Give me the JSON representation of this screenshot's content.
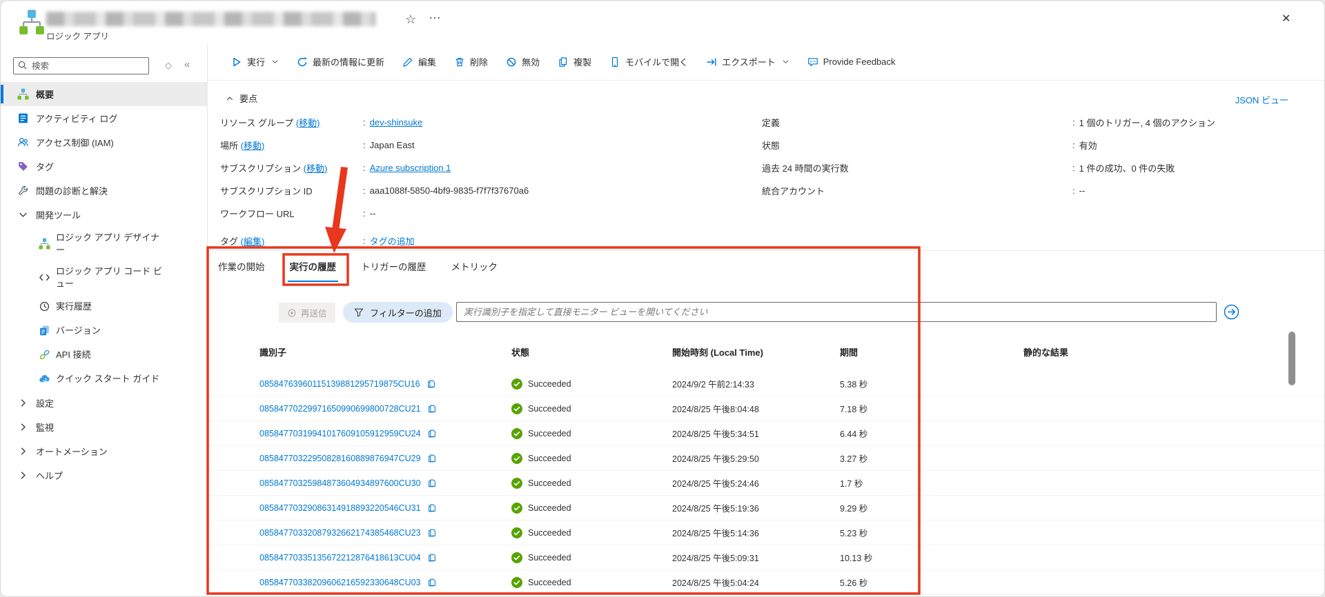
{
  "window": {
    "close": "✕"
  },
  "header": {
    "app_type_label": "ロジック アプリ",
    "star": "☆",
    "more": "…"
  },
  "sidebar": {
    "search_placeholder": "検索",
    "pin": "◇",
    "collapse": "«",
    "items": [
      {
        "label": "概要",
        "icon": "logic-app-icon",
        "cls": "selected"
      },
      {
        "label": "アクティビティ ログ",
        "icon": "activity-log-icon"
      },
      {
        "label": "アクセス制御 (IAM)",
        "icon": "access-control-icon"
      },
      {
        "label": "タグ",
        "icon": "tag-icon"
      },
      {
        "label": "問題の診断と解決",
        "icon": "diagnose-icon"
      },
      {
        "label": "開発ツール",
        "icon": "chevron-down-icon",
        "cls": "group"
      },
      {
        "label": "ロジック アプリ デザイナー",
        "icon": "designer-icon",
        "cls": "sub"
      },
      {
        "label": "ロジック アプリ コード ビュー",
        "icon": "code-view-icon",
        "cls": "sub"
      },
      {
        "label": "実行履歴",
        "icon": "run-history-icon",
        "cls": "sub"
      },
      {
        "label": "バージョン",
        "icon": "versions-icon",
        "cls": "sub"
      },
      {
        "label": "API 接続",
        "icon": "api-connections-icon",
        "cls": "sub"
      },
      {
        "label": "クイック スタート ガイド",
        "icon": "quickstart-icon",
        "cls": "sub"
      },
      {
        "label": "設定",
        "icon": "chevron-right-icon",
        "cls": "group"
      },
      {
        "label": "監視",
        "icon": "chevron-right-icon",
        "cls": "group"
      },
      {
        "label": "オートメーション",
        "icon": "chevron-right-icon",
        "cls": "group"
      },
      {
        "label": "ヘルプ",
        "icon": "chevron-right-icon",
        "cls": "group"
      }
    ]
  },
  "toolbar": {
    "buttons": [
      {
        "label": "実行",
        "icon": "play-icon",
        "caret": true
      },
      {
        "label": "最新の情報に更新",
        "icon": "refresh-icon"
      },
      {
        "label": "編集",
        "icon": "edit-icon"
      },
      {
        "label": "削除",
        "icon": "delete-icon"
      },
      {
        "label": "無効",
        "icon": "disable-icon"
      },
      {
        "label": "複製",
        "icon": "clone-icon"
      },
      {
        "label": "モバイルで開く",
        "icon": "mobile-icon"
      },
      {
        "label": "エクスポート",
        "icon": "export-icon",
        "caret": true
      },
      {
        "label": "Provide Feedback",
        "icon": "feedback-icon"
      }
    ]
  },
  "essentials": {
    "title": "要点",
    "json_view_label": "JSON ビュー",
    "left": [
      {
        "label": "リソース グループ",
        "link": "(移動)",
        "sep": ":",
        "value": "dev-shinsuke",
        "value_style": "ulink"
      },
      {
        "label": "場所",
        "link": "(移動)",
        "sep": ":",
        "value": "Japan East"
      },
      {
        "label": "サブスクリプション",
        "link": "(移動)",
        "sep": ":",
        "value": "Azure subscription 1",
        "value_style": "ulink"
      },
      {
        "label": "サブスクリプション ID",
        "sep": ":",
        "value": "aaa1088f-5850-4bf9-9835-f7f7f37670a6"
      },
      {
        "label": "ワークフロー URL",
        "sep": ":",
        "value": "--"
      },
      {
        "label": "タグ",
        "link": "(編集)",
        "sep": ":",
        "value": "タグの追加",
        "value_style": "link"
      }
    ],
    "right": [
      {
        "label": "定義",
        "sep": ":",
        "value": "1 個のトリガー, 4 個のアクション"
      },
      {
        "label": "状態",
        "sep": ":",
        "value": "有効"
      },
      {
        "label": "過去 24 時間の実行数",
        "sep": ":",
        "value": "1 件の成功、0 件の失敗"
      },
      {
        "label": "統合アカウント",
        "sep": ":",
        "value": "--"
      }
    ]
  },
  "tabs": [
    {
      "label": "作業の開始"
    },
    {
      "label": "実行の履歴",
      "active": true
    },
    {
      "label": "トリガーの履歴"
    },
    {
      "label": "メトリック"
    }
  ],
  "run_history": {
    "resubmit_label": "再送信",
    "add_filter_label": "フィルターの追加",
    "search_placeholder": "実行識別子を指定して直接モニター ビューを開いてください",
    "columns": [
      "識別子",
      "状態",
      "開始時刻 (Local Time)",
      "期間",
      "静的な結果"
    ],
    "rows": [
      {
        "id": "08584763960115139881295719875CU16",
        "status": "Succeeded",
        "start": "2024/9/2 午前2:14:33",
        "duration": "5.38 秒"
      },
      {
        "id": "08584770229971650990699800728CU21",
        "status": "Succeeded",
        "start": "2024/8/25 午後8:04:48",
        "duration": "7.18 秒"
      },
      {
        "id": "08584770319941017609105912959CU24",
        "status": "Succeeded",
        "start": "2024/8/25 午後5:34:51",
        "duration": "6.44 秒"
      },
      {
        "id": "08584770322950828160889876947CU29",
        "status": "Succeeded",
        "start": "2024/8/25 午後5:29:50",
        "duration": "3.27 秒"
      },
      {
        "id": "08584770325984873604934897600CU30",
        "status": "Succeeded",
        "start": "2024/8/25 午後5:24:46",
        "duration": "1.7 秒"
      },
      {
        "id": "08584770329086314918893220546CU31",
        "status": "Succeeded",
        "start": "2024/8/25 午後5:19:36",
        "duration": "9.29 秒"
      },
      {
        "id": "08584770332087932662174385468CU23",
        "status": "Succeeded",
        "start": "2024/8/25 午後5:14:36",
        "duration": "5.23 秒"
      },
      {
        "id": "08584770335135672212876418613CU04",
        "status": "Succeeded",
        "start": "2024/8/25 午後5:09:31",
        "duration": "10.13 秒"
      },
      {
        "id": "08584770338209606216592330648CU03",
        "status": "Succeeded",
        "start": "2024/8/25 午後5:04:24",
        "duration": "5.26 秒"
      }
    ]
  },
  "colors": {
    "accent": "#0078d4",
    "success": "#57a300",
    "annotation": "#e8371d"
  }
}
